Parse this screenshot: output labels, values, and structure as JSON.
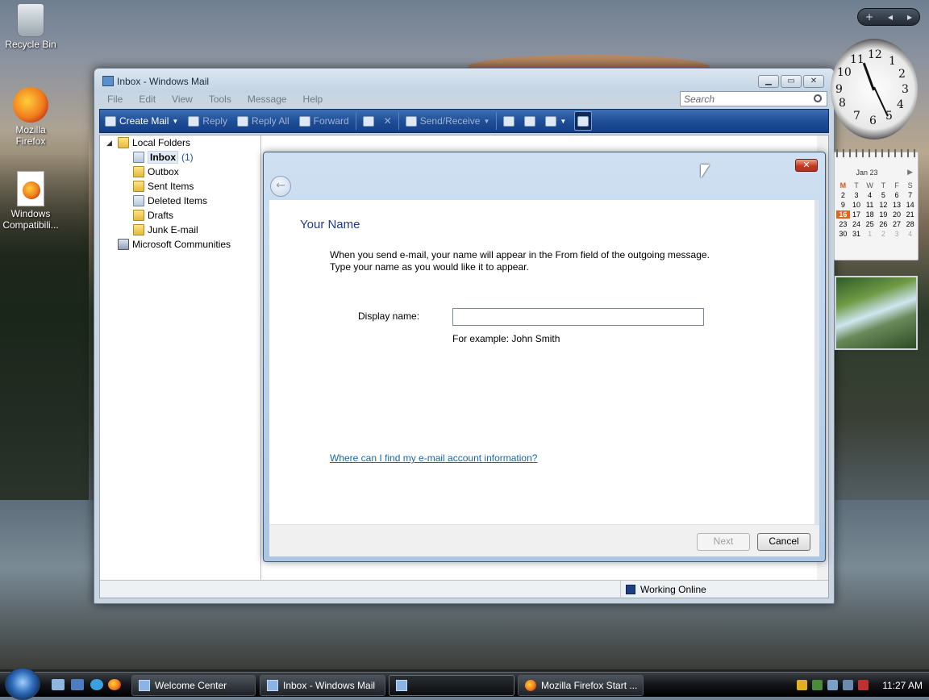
{
  "desktop": {
    "icons": [
      {
        "label": "Recycle Bin"
      },
      {
        "label": "Mozilla Firefox"
      },
      {
        "label": "Windows Compatibili..."
      }
    ]
  },
  "window": {
    "title": "Inbox - Windows Mail",
    "menu": [
      "File",
      "Edit",
      "View",
      "Tools",
      "Message",
      "Help"
    ],
    "search_placeholder": "Search",
    "toolbar": {
      "create_mail": "Create Mail",
      "reply": "Reply",
      "reply_all": "Reply All",
      "forward": "Forward",
      "send_receive": "Send/Receive"
    },
    "folders": {
      "root": "Local Folders",
      "inbox": "Inbox",
      "inbox_count": "(1)",
      "outbox": "Outbox",
      "sent": "Sent Items",
      "deleted": "Deleted Items",
      "drafts": "Drafts",
      "junk": "Junk E-mail",
      "communities": "Microsoft Communities"
    },
    "status": "Working Online"
  },
  "dialog": {
    "heading": "Your Name",
    "description_line1": "When you send e-mail, your name will appear in the From field of the outgoing message.",
    "description_line2": "Type your name as you would like it to appear.",
    "display_name_label": "Display name:",
    "display_name_value": "",
    "example": "For example: John Smith",
    "help_link": "Where can I find my e-mail account information?",
    "next": "Next",
    "cancel": "Cancel"
  },
  "gadgets": {
    "clock_numbers": [
      "12",
      "1",
      "2",
      "3",
      "4",
      "5",
      "6",
      "7",
      "8",
      "9",
      "10",
      "11"
    ],
    "calendar": {
      "month": "Jan 23",
      "dow": [
        "M",
        "T",
        "W",
        "T",
        "F",
        "S"
      ],
      "rows": [
        [
          "2",
          "3",
          "4",
          "5",
          "6",
          "7"
        ],
        [
          "9",
          "10",
          "11",
          "12",
          "13",
          "14"
        ],
        [
          "16",
          "17",
          "18",
          "19",
          "20",
          "21"
        ],
        [
          "23",
          "24",
          "25",
          "26",
          "27",
          "28"
        ],
        [
          "30",
          "31",
          "1",
          "2",
          "3",
          "4"
        ]
      ],
      "today": "16"
    }
  },
  "taskbar": {
    "tasks": [
      "Welcome Center",
      "Inbox - Windows Mail",
      "",
      "Mozilla Firefox Start ..."
    ],
    "time": "11:27 AM"
  }
}
